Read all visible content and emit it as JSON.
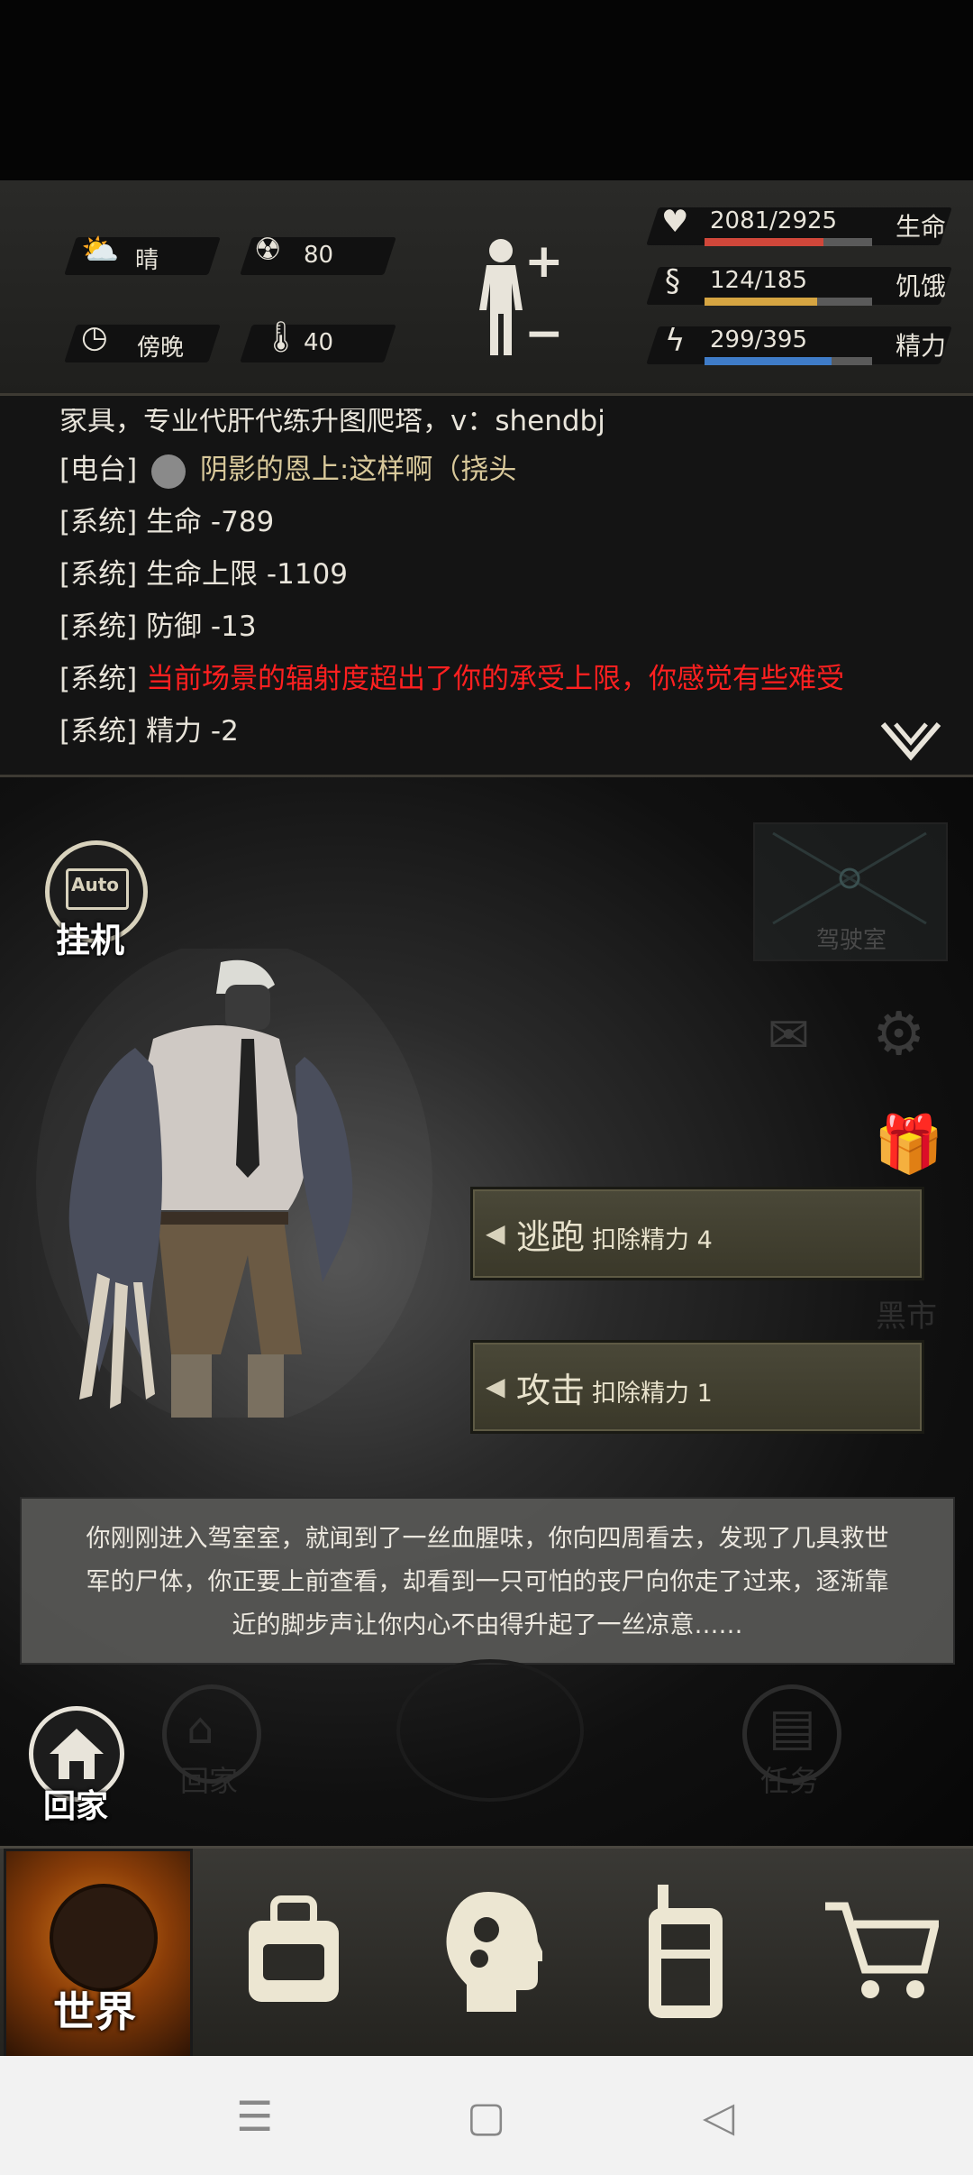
{
  "status": {
    "weather": "晴",
    "radiation": "80",
    "time_of_day": "傍晚",
    "temperature": "40",
    "body_plus": "+",
    "body_minus": "−",
    "stats": [
      {
        "value": "2081/2925",
        "label": "生命",
        "fraction": 0.711,
        "color": "#d0473a"
      },
      {
        "value": "124/185",
        "label": "饥饿",
        "fraction": 0.67,
        "color": "#d6a542"
      },
      {
        "value": "299/395",
        "label": "精力",
        "fraction": 0.757,
        "color": "#3f7cc8"
      }
    ]
  },
  "chat": {
    "lines": [
      {
        "prefix": "",
        "text": "家具，专业代肝代练升图爬塔，v：shendbj"
      },
      {
        "prefix": "[电台]",
        "text": "阴影的恩上:这样啊（挠头"
      },
      {
        "prefix": "[系统]",
        "text": "生命 -789"
      },
      {
        "prefix": "[系统]",
        "text": "生命上限 -1109"
      },
      {
        "prefix": "[系统]",
        "text": "防御 -13"
      },
      {
        "prefix": "[系统]",
        "text": "当前场景的辐射度超出了你的承受上限，你感觉有些难受"
      },
      {
        "prefix": "[系统]",
        "text": "精力 -2"
      }
    ],
    "collapse_icon": "double-chevron-down-icon"
  },
  "scene": {
    "auto_label": "Auto",
    "auto_caption": "挂机",
    "room_label": "驾驶室",
    "blackmarket_label": "黑市",
    "actions": [
      {
        "label": "逃跑",
        "cost": "扣除精力 4"
      },
      {
        "label": "攻击",
        "cost": "扣除精力 1"
      }
    ],
    "story": [
      "你刚刚进入驾室室，就闻到了一丝血腥味，你向四周看去，发现了几具救世",
      "军的尸体，你正要上前查看，却看到一只可怕的丧尸向你走了过来，逐渐靠",
      "近的脚步声让你内心不由得升起了一丝凉意……"
    ],
    "home_label": "回家",
    "home_label_faded": "回家",
    "task_label": "任务"
  },
  "nav": {
    "world_label": "世界",
    "items": [
      "world-icon",
      "backpack-icon",
      "brain-icon",
      "radio-icon",
      "cart-icon"
    ]
  }
}
